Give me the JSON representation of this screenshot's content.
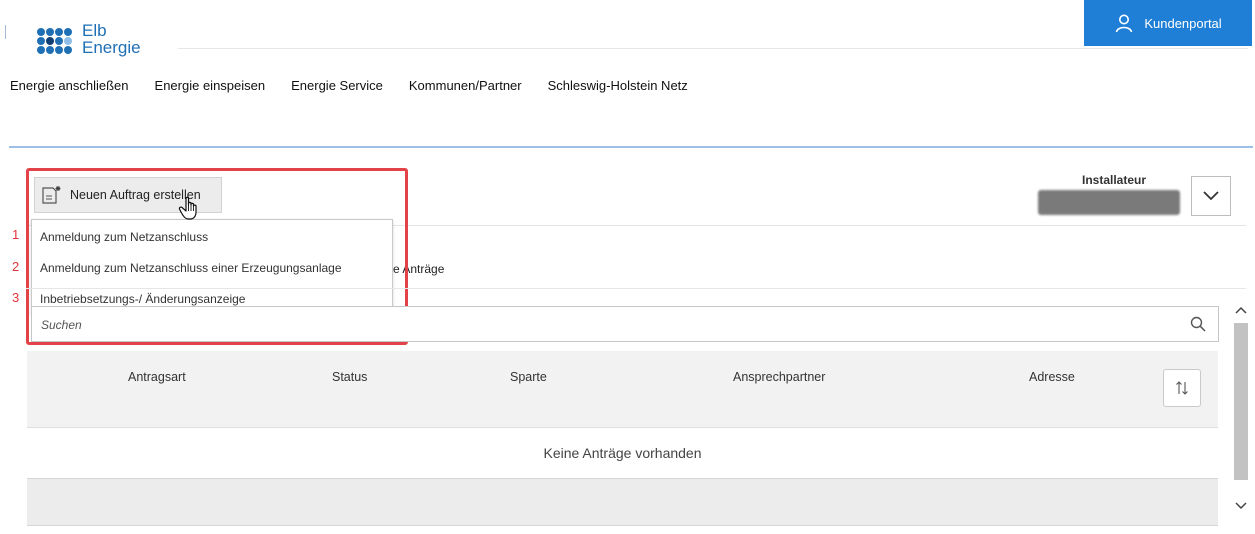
{
  "brand": {
    "line1": "Elb",
    "line2": "Energie",
    "logo_icon": "elbenergie-logo-icon"
  },
  "header": {
    "portal_label": "Kundenportal",
    "portal_icon": "user-icon",
    "portal_color": "#1f7fd6"
  },
  "nav": {
    "items": [
      {
        "label": "Energie anschließen"
      },
      {
        "label": "Energie einspeisen"
      },
      {
        "label": "Energie Service"
      },
      {
        "label": "Kommunen/Partner"
      },
      {
        "label": "Schleswig-Holstein Netz"
      }
    ]
  },
  "installer": {
    "label": "Installateur",
    "dropdown_icon": "chevron-down-icon"
  },
  "create": {
    "button_label": "Neuen Auftrag erstellen",
    "button_icon": "new-document-icon",
    "menu": [
      {
        "num": "1",
        "label": "Anmeldung zum Netzanschluss"
      },
      {
        "num": "2",
        "label": "Anmeldung zum Netzanschluss einer Erzeugungsanlage"
      },
      {
        "num": "3",
        "label": "Inbetriebsetzungs-/ Änderungsanzeige"
      }
    ],
    "highlight_color": "#e24248"
  },
  "tabs": {
    "partial_label": "e Anträge"
  },
  "search": {
    "placeholder": "Suchen",
    "icon": "search-icon"
  },
  "table": {
    "columns": [
      "Antragsart",
      "Status",
      "Sparte",
      "Ansprechpartner",
      "Adresse"
    ],
    "sort_icon": "sort-icon",
    "empty_message": "Keine Anträge vorhanden"
  }
}
